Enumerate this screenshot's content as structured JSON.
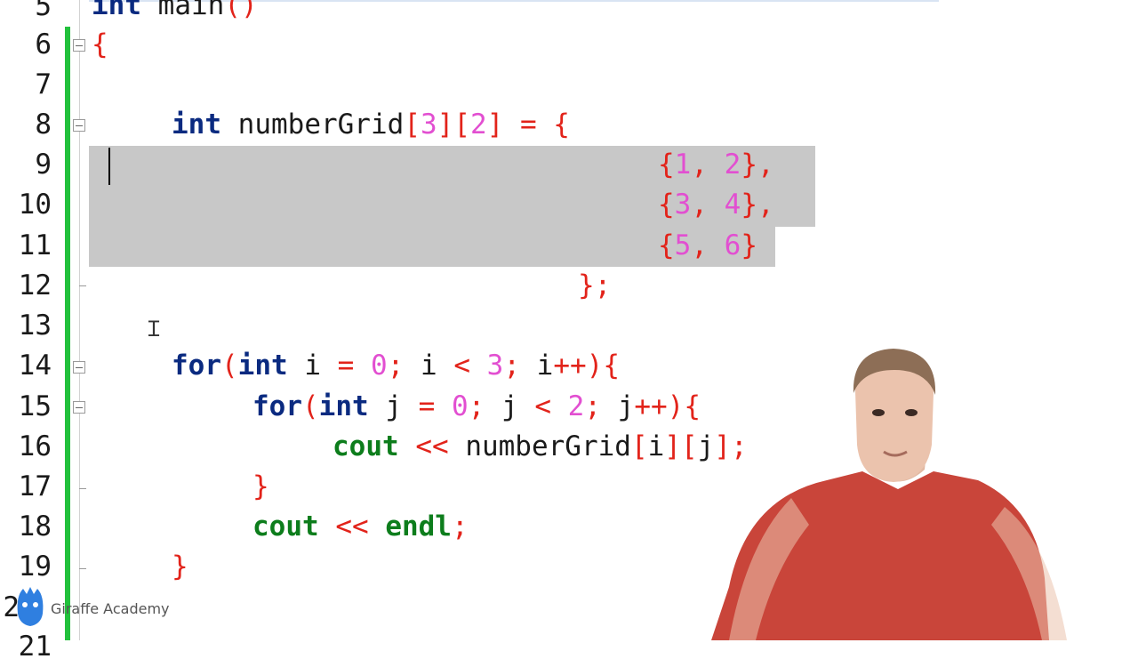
{
  "gutter": {
    "line_numbers": [
      "5",
      "6",
      "7",
      "8",
      "9",
      "10",
      "11",
      "12",
      "13",
      "14",
      "15",
      "16",
      "17",
      "18",
      "19",
      "2",
      "21"
    ]
  },
  "code": {
    "line5": {
      "kw": "int",
      "id": " main",
      "op": "()"
    },
    "line6": {
      "op": "{"
    },
    "line8": {
      "kw": "int",
      "id": " numberGrid",
      "o1": "[",
      "n1": "3",
      "o2": "][",
      "n2": "2",
      "o3": "] = {"
    },
    "line9": {
      "o1": "{",
      "n1": "1",
      "o2": ", ",
      "n2": "2",
      "o3": "},"
    },
    "line10": {
      "o1": "{",
      "n1": "3",
      "o2": ", ",
      "n2": "4",
      "o3": "},"
    },
    "line11": {
      "o1": "{",
      "n1": "5",
      "o2": ", ",
      "n2": "6",
      "o3": "}"
    },
    "line12": {
      "op": "};"
    },
    "line14": {
      "kw1": "for",
      "o1": "(",
      "kw2": "int",
      "id1": " i ",
      "o2": "= ",
      "n1": "0",
      "o3": "; ",
      "id2": "i ",
      "o4": "< ",
      "n2": "3",
      "o5": "; ",
      "id3": "i",
      "o6": "++){"
    },
    "line15": {
      "kw1": "for",
      "o1": "(",
      "kw2": "int",
      "id1": " j ",
      "o2": "= ",
      "n1": "0",
      "o3": "; ",
      "id2": "j ",
      "o4": "< ",
      "n2": "2",
      "o5": "; ",
      "id3": "j",
      "o6": "++){"
    },
    "line16": {
      "fn": "cout",
      "o1": " << ",
      "id1": "numberGrid",
      "o2": "[",
      "id2": "i",
      "o3": "][",
      "id3": "j",
      "o4": "];"
    },
    "line17": {
      "op": "}"
    },
    "line18": {
      "fn1": "cout",
      "o1": " << ",
      "fn2": "endl",
      "o2": ";"
    },
    "line19": {
      "op": "}"
    }
  },
  "branding": {
    "label": "Giraffe Academy"
  },
  "colors": {
    "keyword": "#0a2a80",
    "operator": "#e2231a",
    "number": "#e24fd1",
    "stream": "#0d7d1c",
    "selection": "#c8c8c8",
    "change_bar": "#22c13c"
  }
}
